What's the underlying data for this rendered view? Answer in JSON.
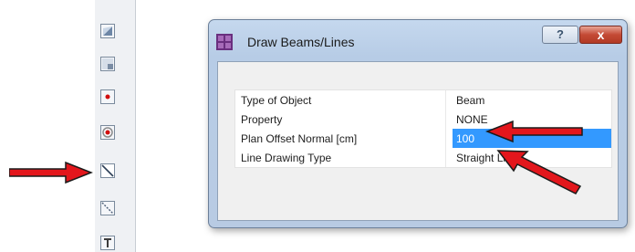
{
  "toolbar": {
    "icons": [
      "surface-shape-icon",
      "box-shape-icon",
      "point-icon",
      "target-point-icon",
      "draw-line-icon",
      "draw-diagonal-line-icon",
      "text-tool-icon"
    ]
  },
  "dialog": {
    "title": "Draw Beams/Lines",
    "help_label": "?",
    "close_label": "x",
    "rows": [
      {
        "label": "Type of Object",
        "value": "Beam"
      },
      {
        "label": "Property",
        "value": "NONE"
      },
      {
        "label": "Plan Offset Normal  [cm]",
        "value": "100"
      },
      {
        "label": "Line Drawing Type",
        "value": "Straight Line"
      }
    ],
    "selected_row": 2
  },
  "colors": {
    "selection": "#3399ff",
    "arrow": "#e3161c"
  }
}
